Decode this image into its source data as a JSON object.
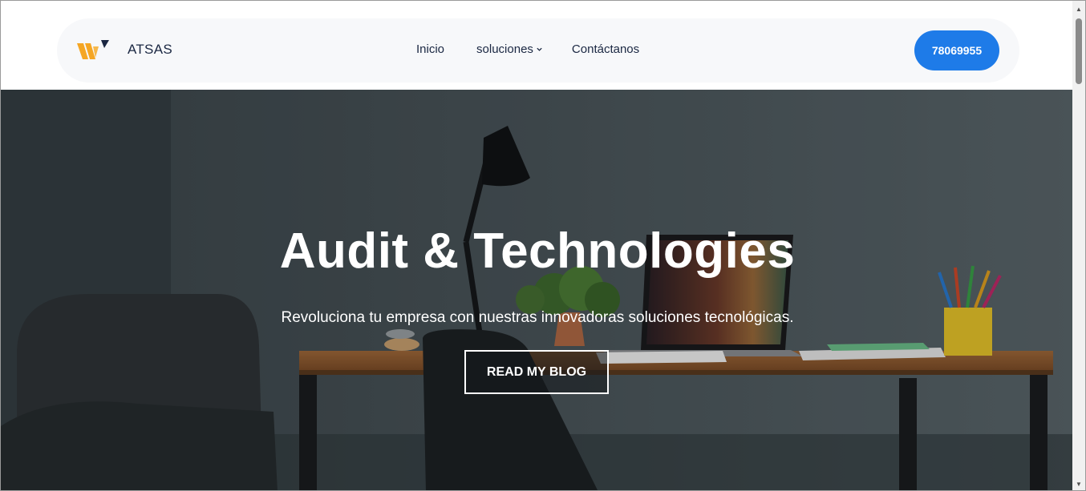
{
  "header": {
    "brand": "ATSAS",
    "nav": {
      "inicio": "Inicio",
      "soluciones": "soluciones",
      "contacto": "Contáctanos"
    },
    "phone": "78069955"
  },
  "hero": {
    "title": "Audit & Technologies",
    "subtitle": "Revoluciona tu empresa con nuestras innovadoras soluciones tecnológicas.",
    "cta": "READ MY BLOG"
  },
  "colors": {
    "accent": "#1e7be8",
    "nav_text": "#1a2742",
    "logo_orange": "#f5a623",
    "logo_dark": "#1a2742"
  },
  "icons": {
    "logo": "atsas-logo-icon",
    "dropdown": "chevron-down-icon",
    "scroll_up": "scroll-up-arrow-icon",
    "scroll_down": "scroll-down-arrow-icon"
  }
}
